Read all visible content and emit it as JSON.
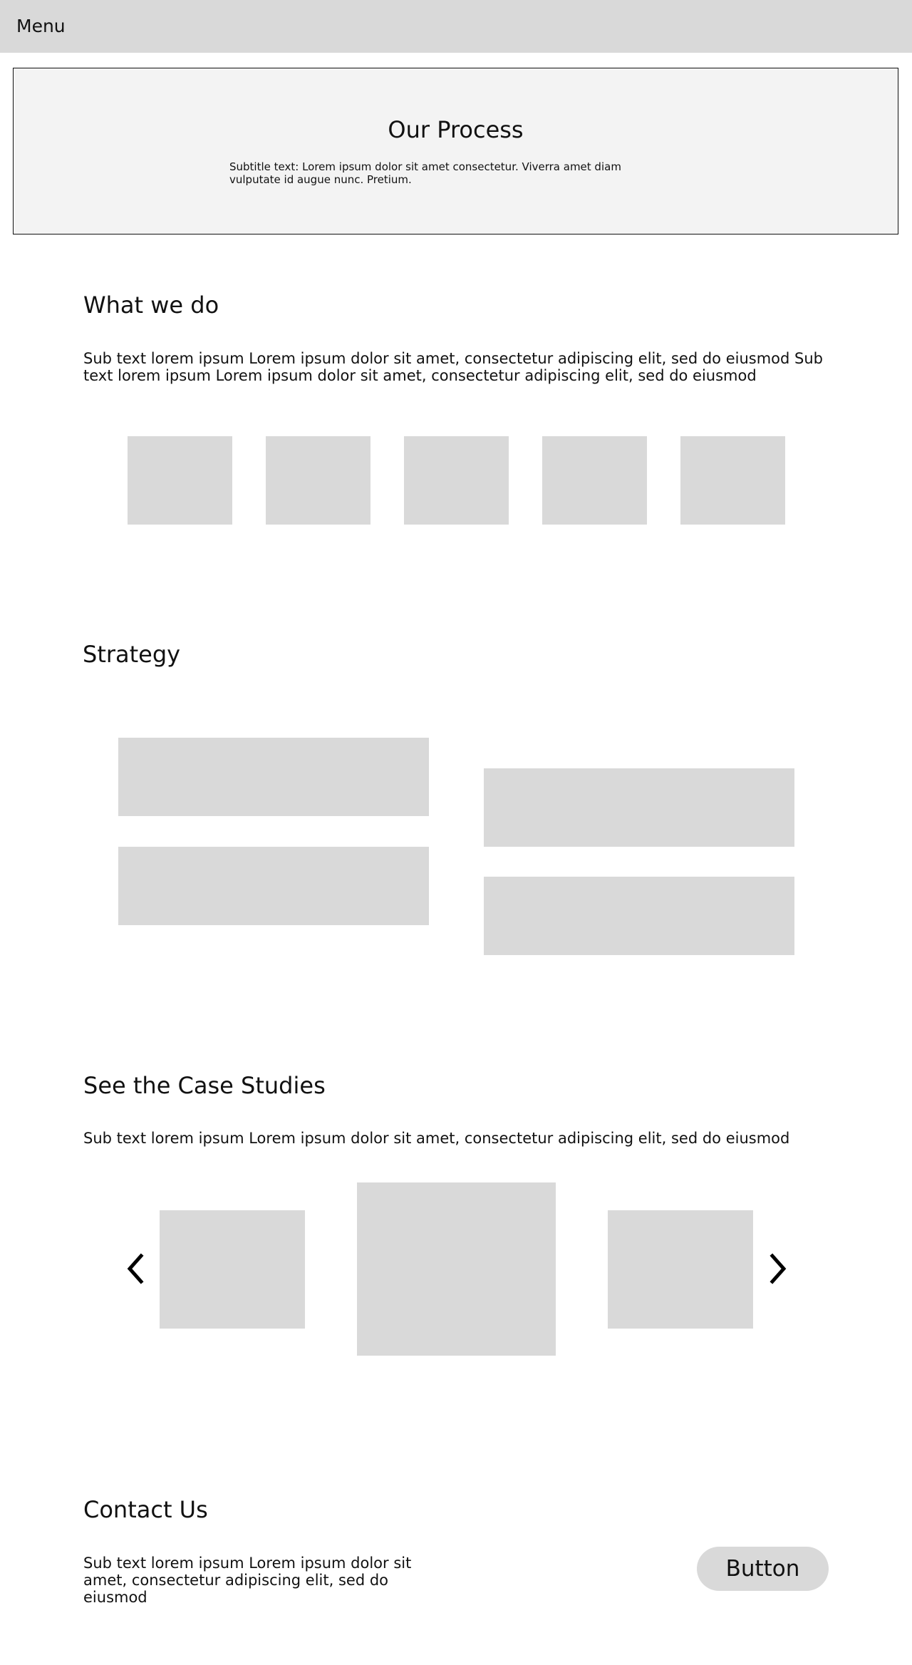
{
  "header": {
    "menu_label": "Menu"
  },
  "hero": {
    "title": "Our Process",
    "subtitle": "Subtitle text: Lorem ipsum dolor sit amet consectetur. Viverra amet diam vulputate id augue nunc. Pretium."
  },
  "what_we_do": {
    "title": "What we do",
    "subtext": "Sub text lorem ipsum Lorem ipsum dolor sit amet, consectetur adipiscing elit, sed do eiusmod Sub text lorem ipsum Lorem ipsum dolor sit amet, consectetur adipiscing elit, sed do eiusmod"
  },
  "strategy": {
    "title": "Strategy"
  },
  "case_studies": {
    "title": "See the Case Studies",
    "subtext": "Sub text lorem ipsum Lorem ipsum dolor sit amet, consectetur adipiscing elit, sed do eiusmod",
    "prev_icon": "chevron-left-icon",
    "next_icon": "chevron-right-icon"
  },
  "contact": {
    "title": "Contact Us",
    "subtext": "Sub text lorem ipsum Lorem ipsum dolor sit amet, consectetur adipiscing elit, sed do eiusmod",
    "button_label": "Button"
  },
  "colors": {
    "placeholder": "#d9d9d9",
    "header_bg": "#d9d9d9",
    "hero_bg": "#f3f3f3",
    "text": "#111111"
  }
}
